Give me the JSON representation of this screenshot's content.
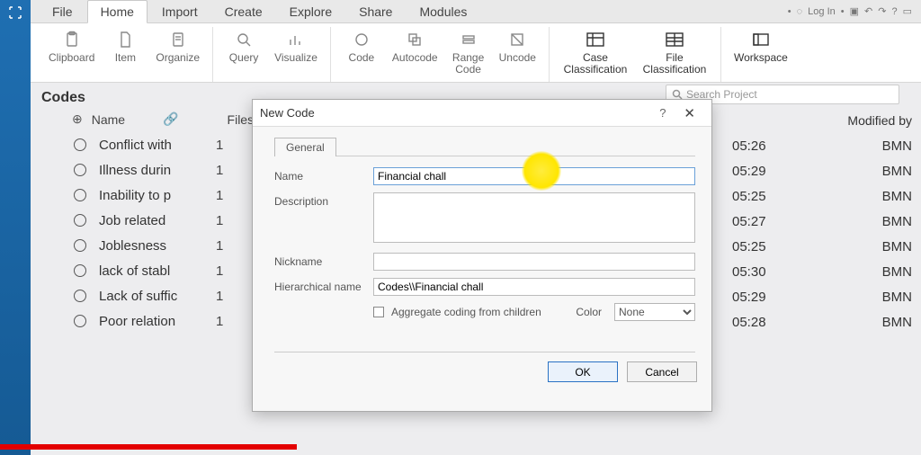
{
  "tabs": {
    "file": "File",
    "home": "Home",
    "import": "Import",
    "create": "Create",
    "explore": "Explore",
    "share": "Share",
    "modules": "Modules"
  },
  "topRight": {
    "login": "Log In"
  },
  "ribbon": {
    "clipboard": "Clipboard",
    "item": "Item",
    "organize": "Organize",
    "query": "Query",
    "visualize": "Visualize",
    "code": "Code",
    "autocode": "Autocode",
    "rangecode": "Range\nCode",
    "uncode": "Uncode",
    "caseclass": "Case\nClassification",
    "fileclass": "File\nClassification",
    "workspace": "Workspace"
  },
  "panel": {
    "title": "Codes",
    "nameCol": "Name",
    "filesCol": "Files",
    "modifiedByCol": "Modified by"
  },
  "codes": [
    {
      "name": "Conflict with",
      "files": "1",
      "time": "05:26",
      "by": "BMN"
    },
    {
      "name": "Illness durin",
      "files": "1",
      "time": "05:29",
      "by": "BMN"
    },
    {
      "name": "Inability to p",
      "files": "1",
      "time": "05:25",
      "by": "BMN"
    },
    {
      "name": "Job related",
      "files": "1",
      "time": "05:27",
      "by": "BMN"
    },
    {
      "name": "Joblesness",
      "files": "1",
      "time": "05:25",
      "by": "BMN"
    },
    {
      "name": "lack of stabl",
      "files": "1",
      "time": "05:30",
      "by": "BMN"
    },
    {
      "name": "Lack of suffic",
      "files": "1",
      "time": "05:29",
      "by": "BMN"
    },
    {
      "name": "Poor relation",
      "files": "1",
      "time": "05:28",
      "by": "BMN"
    }
  ],
  "search": {
    "placeholder": "Search Project"
  },
  "dialog": {
    "title": "New Code",
    "tab": "General",
    "nameLabel": "Name",
    "nameValue": "Financial chall",
    "descLabel": "Description",
    "descValue": "",
    "nickLabel": "Nickname",
    "nickValue": "",
    "hierLabel": "Hierarchical name",
    "hierValue": "Codes\\\\Financial chall",
    "aggLabel": "Aggregate coding from children",
    "colorLabel": "Color",
    "colorValue": "None",
    "ok": "OK",
    "cancel": "Cancel"
  }
}
